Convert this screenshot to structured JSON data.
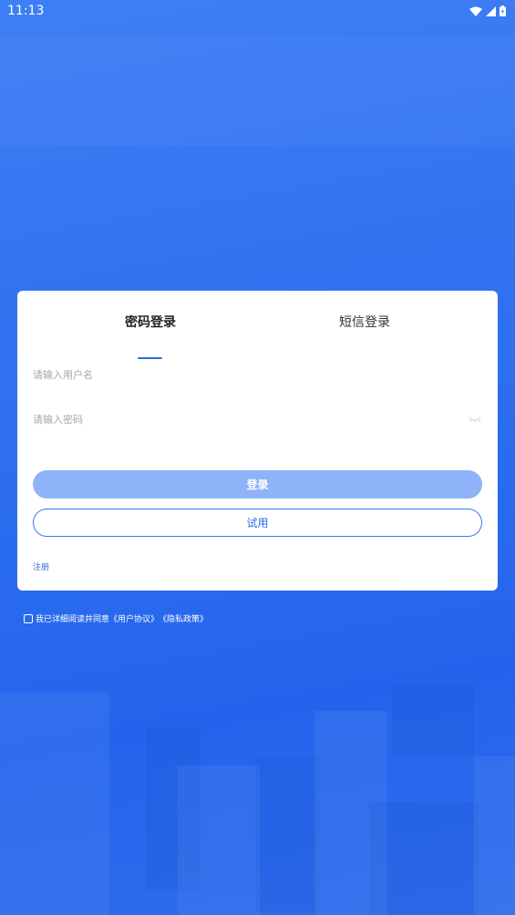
{
  "status_bar": {
    "time": "11:13",
    "icons": [
      "wifi-icon",
      "cellular-signal-icon",
      "battery-icon"
    ]
  },
  "login_card": {
    "tabs": [
      {
        "label": "密码登录",
        "active": true
      },
      {
        "label": "短信登录",
        "active": false
      }
    ],
    "username_placeholder": "请输入用户名",
    "password_placeholder": "请输入密码",
    "login_button": "登录",
    "trial_button": "试用",
    "register_link": "注册"
  },
  "agreement": {
    "prefix": "我已详细阅读并同意",
    "user_agreement": "《用户协议》",
    "privacy_policy": "《隐私政策》",
    "checked": false
  },
  "colors": {
    "accent": "#2b6ae0",
    "login_button_bg": "#8eb3f9",
    "background": "#2d6ded"
  }
}
